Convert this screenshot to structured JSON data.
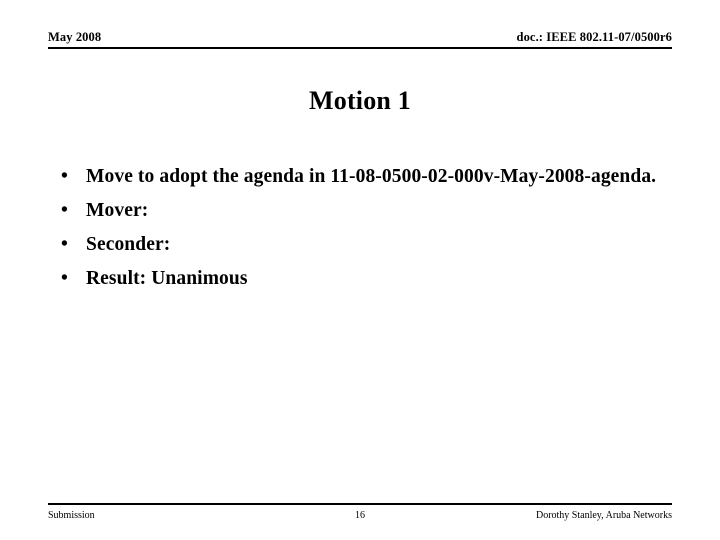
{
  "header": {
    "left": "May 2008",
    "right": "doc.: IEEE 802.11-07/0500r6"
  },
  "title": "Motion 1",
  "body": {
    "bullet_glyph": "•",
    "items": [
      "Move to adopt the agenda in 11-08-0500-02-000v-May-2008-agenda.",
      "Mover:",
      "Seconder:",
      "Result: Unanimous"
    ]
  },
  "footer": {
    "left": "Submission",
    "page_number": "16",
    "right": "Dorothy Stanley, Aruba Networks"
  },
  "colors": {
    "background": "#ffffff",
    "text": "#000000",
    "rule": "#000000"
  }
}
